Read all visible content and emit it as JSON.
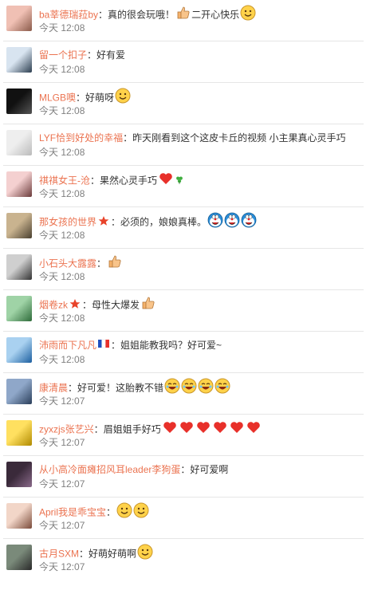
{
  "colors": {
    "name": "#eb7350",
    "text": "#333333",
    "time": "#808080",
    "divider": "#e6e6e6"
  },
  "comments": [
    {
      "name": "ba莘德瑞菈by",
      "colon": "：",
      "text": "真的很会玩哦！",
      "text2": "二开心快乐",
      "emojis": [
        "thumbs-up-icon",
        "smile-icon"
      ],
      "time": "今天 12:08",
      "avatar": [
        "#f0c0b4",
        "#8a5a4a"
      ]
    },
    {
      "name": "留一个扣子",
      "colon": "：",
      "text": "好有爱",
      "emojis": [],
      "time": "今天 12:08",
      "avatar": [
        "#d8e4f0",
        "#2c3e50"
      ]
    },
    {
      "name": "MLGB噢",
      "colon": "：",
      "text": "好萌呀",
      "emojis": [
        "smile-icon"
      ],
      "time": "今天 12:08",
      "avatar": [
        "#111111",
        "#555555"
      ]
    },
    {
      "name": "LYF恰到好处的幸福",
      "colon": "：",
      "text": "昨天刚看到这个这皮卡丘的视频  小主果真心灵手巧",
      "emojis": [],
      "time": "今天 12:08",
      "avatar": [
        "#eeeeee",
        "#bbbbbb"
      ]
    },
    {
      "name": "祺祺女王-沧",
      "colon": "：",
      "text": "果然心灵手巧",
      "emojis": [
        "heart-icon",
        "clover-icon"
      ],
      "time": "今天 12:08",
      "avatar": [
        "#f4d0d0",
        "#6b3b3b"
      ]
    },
    {
      "name": "那女孩的世界",
      "colon": "：",
      "text": "必须的，娘娘真棒。",
      "badge": "star-badge-icon",
      "emojis": [
        "doraemon-icon",
        "doraemon-icon",
        "doraemon-icon"
      ],
      "time": "今天 12:08",
      "avatar": [
        "#c9b38f",
        "#4a4030"
      ]
    },
    {
      "name": "小石头大露露",
      "colon": "：",
      "text": "",
      "emojis": [
        "thumbs-up-icon"
      ],
      "time": "今天 12:08",
      "avatar": [
        "#cfcfcf",
        "#333333"
      ]
    },
    {
      "name": "烟卷zk",
      "colon": "：",
      "text": "母性大爆发",
      "badge": "star-badge-icon",
      "emojis": [
        "thumbs-up-icon"
      ],
      "time": "今天 12:08",
      "avatar": [
        "#9fd3a6",
        "#2e6b3a"
      ]
    },
    {
      "name": "沛雨而下凡凡",
      "colon": "：",
      "text": "姐姐能教我吗？好可爱~",
      "badge": "flag-badge-icon",
      "emojis": [],
      "time": "今天 12:08",
      "avatar": [
        "#a9d1f0",
        "#1d5fa0"
      ]
    },
    {
      "name": "康清晨",
      "colon": "：",
      "text": "好可爱！这胎教不错",
      "emojis": [
        "laugh-icon",
        "laugh-icon",
        "laugh-icon",
        "laugh-icon"
      ],
      "time": "今天 12:07",
      "avatar": [
        "#8fa7c9",
        "#2a3e5a"
      ]
    },
    {
      "name": "zyxzjs张艺兴",
      "colon": "：",
      "text": "眉姐姐手好巧",
      "emojis": [
        "heart-icon",
        "heart-icon",
        "heart-icon",
        "heart-icon",
        "heart-icon",
        "heart-icon"
      ],
      "time": "今天 12:07",
      "avatar": [
        "#ffe060",
        "#b08a00"
      ]
    },
    {
      "name": "从小高冷面瘫招风耳leader李狗蛋",
      "colon": "：",
      "text": "好可爱啊",
      "emojis": [],
      "time": "今天 12:07",
      "avatar": [
        "#3a2a3a",
        "#8a6a8a"
      ]
    },
    {
      "name": "April我是乖宝宝",
      "colon": "：",
      "text": "",
      "emojis": [
        "smile-icon",
        "smile-icon"
      ],
      "time": "今天 12:07",
      "avatar": [
        "#f2d6c8",
        "#7a4a3a"
      ]
    },
    {
      "name": "古月SXM",
      "colon": "：",
      "text": "好萌好萌啊",
      "emojis": [
        "smile-icon"
      ],
      "time": "今天 12:07",
      "avatar": [
        "#7a8a7a",
        "#2a2a2a"
      ]
    }
  ]
}
